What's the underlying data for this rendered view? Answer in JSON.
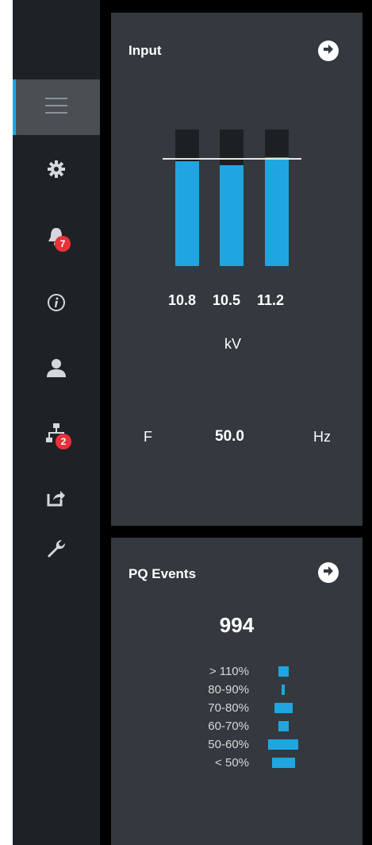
{
  "sidebar": {
    "items": [
      {
        "name": "menu",
        "icon": "hamburger-icon",
        "active": true
      },
      {
        "name": "settings",
        "icon": "gear-icon"
      },
      {
        "name": "alarms",
        "icon": "bell-icon",
        "badge": "7"
      },
      {
        "name": "info",
        "icon": "info-icon"
      },
      {
        "name": "user",
        "icon": "user-icon"
      },
      {
        "name": "network",
        "icon": "network-icon",
        "badge": "2"
      },
      {
        "name": "export",
        "icon": "export-icon"
      },
      {
        "name": "tools",
        "icon": "wrench-icon"
      }
    ],
    "active_color": "#1fa6e0",
    "badge_color": "#e8323b"
  },
  "input_panel": {
    "title": "Input",
    "voltages": [
      "10.8",
      "10.5",
      "11.2"
    ],
    "voltage_unit": "kV",
    "voltage_levels": [
      0.94,
      0.91,
      0.98
    ],
    "frequency_label": "F",
    "frequency_value": "50.0",
    "frequency_unit": "Hz",
    "bar_color": "#1fa6e0"
  },
  "pq_panel": {
    "title": "PQ Events",
    "total": "994",
    "events": [
      {
        "label": "> 110%",
        "level": 0.35
      },
      {
        "label": "80-90%",
        "level": 0.1
      },
      {
        "label": "70-80%",
        "level": 0.6
      },
      {
        "label": "60-70%",
        "level": 0.35
      },
      {
        "label": "50-60%",
        "level": 1.0
      },
      {
        "label": "< 50%",
        "level": 0.75
      }
    ]
  }
}
